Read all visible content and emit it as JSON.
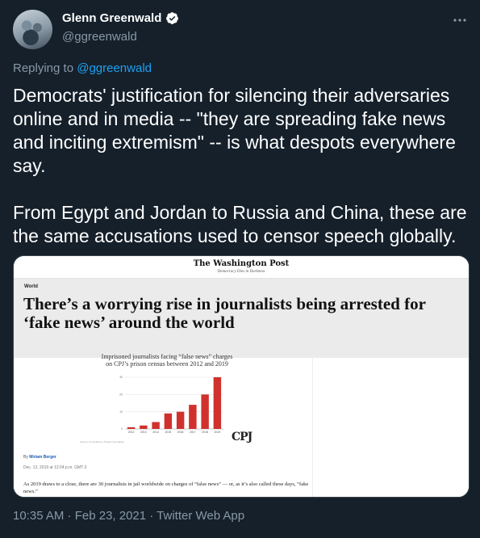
{
  "author": {
    "display_name": "Glenn Greenwald",
    "handle": "@ggreenwald",
    "verified_icon": "verified-badge-icon",
    "more_icon": "more-horizontal-icon"
  },
  "reply": {
    "prefix": "Replying to ",
    "mention": "@ggreenwald"
  },
  "tweet": {
    "text": "Democrats' justification for silencing their adversaries online and in media -- \"they are spreading fake news and inciting extremism\" -- is what despots everywhere say.\n\nFrom Egypt and Jordan to Russia and China, these are the same accusations used to censor speech globally."
  },
  "media": {
    "masthead": "The Washington Post",
    "tagline": "Democracy Dies in Darkness",
    "section": "World",
    "headline": "There’s a worrying rise in journalists being arrested for ‘fake news’ around the world",
    "chart_title_line1": "Imprisoned journalists facing “false news” charges",
    "chart_title_line2": "on CPJ’s prison census between 2012 and 2019",
    "chart_source": "Source: Committee to Protect Journalists",
    "logo": "CPJ",
    "byline_prefix": "By ",
    "byline_author": "Miriam Berger",
    "dateline": "Dec. 12, 2019 at 12:04 p.m. GMT-3",
    "lede": "As 2019 draws to a close, there are 30 journalists in jail worldwide on charges of “false news” — or, as it’s also called these days, “fake news.”"
  },
  "chart_data": {
    "type": "bar",
    "categories": [
      "2012",
      "2013",
      "2014",
      "2015",
      "2016",
      "2017",
      "2018",
      "2019"
    ],
    "values": [
      1,
      2,
      4,
      9,
      10,
      14,
      20,
      30
    ],
    "y_ticks": [
      0,
      10,
      20,
      30
    ],
    "ylim": [
      0,
      30
    ],
    "bar_color": "#d0312d"
  },
  "footer": {
    "meta": "10:35 AM · Feb 23, 2021 · Twitter Web App"
  },
  "colors": {
    "background": "#15202b",
    "accent": "#1da1f2",
    "secondary_text": "#8899a6"
  }
}
